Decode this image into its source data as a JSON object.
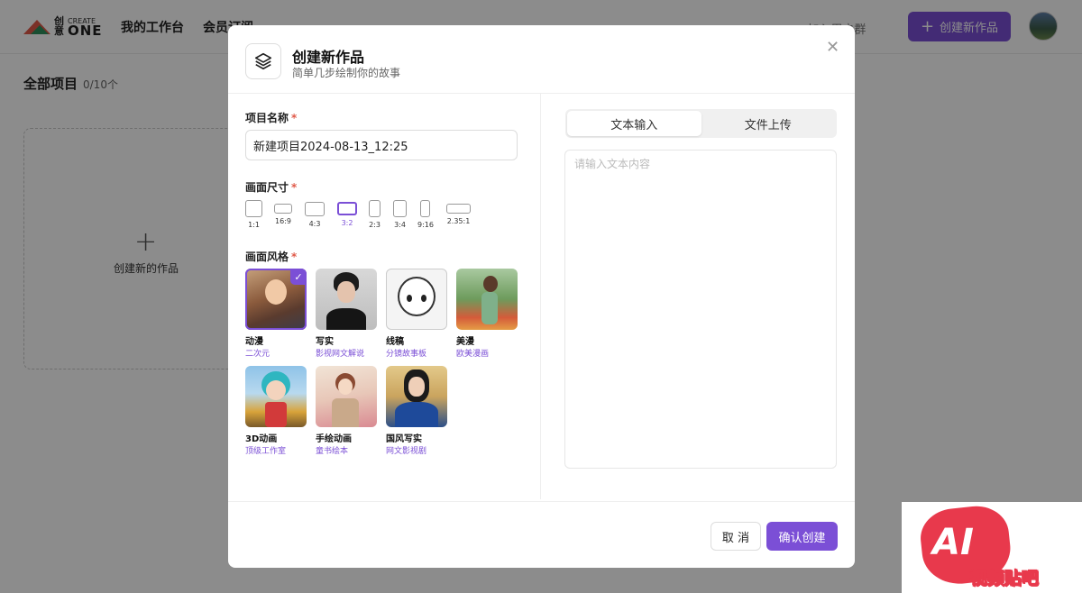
{
  "app": {
    "logo_cn": "创\n意",
    "logo_create": "CREATE",
    "logo_one": "ONE",
    "nav": [
      "我的工作台",
      "会员订阅"
    ],
    "join_group": "加入用户群",
    "create_button": "创建新作品"
  },
  "projects": {
    "title": "全部项目",
    "count": "0/10个",
    "new_card_label": "创建新的作品"
  },
  "modal": {
    "title": "创建新作品",
    "subtitle": "简单几步绘制你的故事",
    "name_label": "项目名称",
    "name_value": "新建项目2024-08-13_12:25",
    "size_label": "画面尺寸",
    "ratios": [
      "1:1",
      "16:9",
      "4:3",
      "3:2",
      "2:3",
      "3:4",
      "9:16",
      "2.35:1"
    ],
    "selected_ratio": "3:2",
    "style_label": "画面风格",
    "styles": [
      {
        "name": "动漫",
        "desc": "二次元"
      },
      {
        "name": "写实",
        "desc": "影视网文解说"
      },
      {
        "name": "线稿",
        "desc": "分镜故事板"
      },
      {
        "name": "美漫",
        "desc": "欧美漫画"
      },
      {
        "name": "3D动画",
        "desc": "顶级工作室"
      },
      {
        "name": "手绘动画",
        "desc": "童书绘本"
      },
      {
        "name": "国风写实",
        "desc": "网文影视剧"
      }
    ],
    "selected_style": "动漫",
    "tabs": [
      "文本输入",
      "文件上传"
    ],
    "active_tab": "文本输入",
    "text_placeholder": "请输入文本内容",
    "cancel": "取 消",
    "confirm": "确认创建"
  },
  "watermark": {
    "ai": "AI",
    "text": "视频贴吧"
  },
  "colors": {
    "accent": "#7b4fd6",
    "required": "#e05a4a",
    "watermark": "#e8394c"
  }
}
